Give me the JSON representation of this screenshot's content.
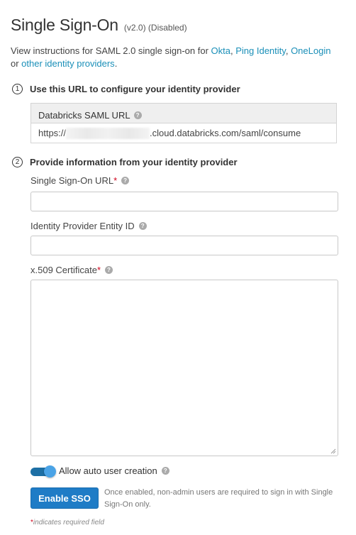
{
  "header": {
    "title": "Single Sign-On",
    "meta": "(v2.0) (Disabled)"
  },
  "intro": {
    "text_before": "View instructions for SAML 2.0 single sign-on for ",
    "link_okta": "Okta",
    "comma1": ", ",
    "link_ping": "Ping Identity",
    "comma2": ", ",
    "link_onelogin": "OneLogin",
    "text_or": " or ",
    "link_other": "other identity providers",
    "period": "."
  },
  "step1": {
    "number": "1",
    "title": "Use this URL to configure your identity provider",
    "box_label": "Databricks SAML URL",
    "url_prefix": "https://",
    "url_suffix": ".cloud.databricks.com/saml/consume"
  },
  "step2": {
    "number": "2",
    "title": "Provide information from your identity provider",
    "sso_url_label": "Single Sign-On URL",
    "sso_url_value": "",
    "entity_id_label": "Identity Provider Entity ID",
    "entity_id_value": "",
    "cert_label": "x.509 Certificate",
    "cert_value": "",
    "required_mark": "*"
  },
  "toggle": {
    "label": "Allow auto user creation",
    "checked": true
  },
  "action": {
    "button_label": "Enable SSO",
    "note": "Once enabled, non-admin users are required to sign in with Single Sign-On only."
  },
  "footnote": {
    "mark": "*",
    "text": "indicates required field"
  },
  "colors": {
    "link": "#1a8fb8",
    "primary_button": "#1f7cc6",
    "toggle_on": "#1d6fa5",
    "required": "#d0021b"
  },
  "icons": {
    "help": "question-circle-icon"
  }
}
